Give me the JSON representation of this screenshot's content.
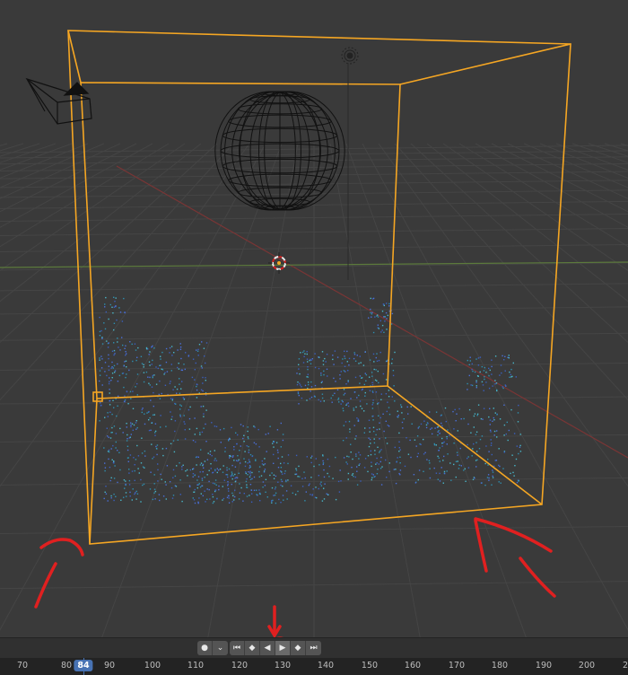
{
  "viewport": {
    "grid_color": "#454545",
    "domain_color": "#f5a623",
    "x_axis_color": "#8a3a3a",
    "y_axis_color": "#5a7a3a",
    "particle_colors": [
      "#3a5fbf",
      "#4a6fd8",
      "#2e8fb0",
      "#49b6c9"
    ],
    "annotation_color": "#e02020"
  },
  "playback": {
    "keyframe_icon": "●",
    "keyframe_dropdown_icon": "⌄",
    "jump_start_icon": "⏮",
    "prev_keyframe_icon": "◆",
    "play_reverse_icon": "◀",
    "play_icon": "▶",
    "next_keyframe_icon": "◆",
    "jump_end_icon": "⏭"
  },
  "timeline": {
    "current_frame": "84",
    "ticks": [
      "70",
      "80",
      "90",
      "100",
      "110",
      "120",
      "130",
      "140",
      "150",
      "160",
      "170",
      "180",
      "190",
      "200",
      "2"
    ],
    "playhead_color": "#4772b3"
  }
}
